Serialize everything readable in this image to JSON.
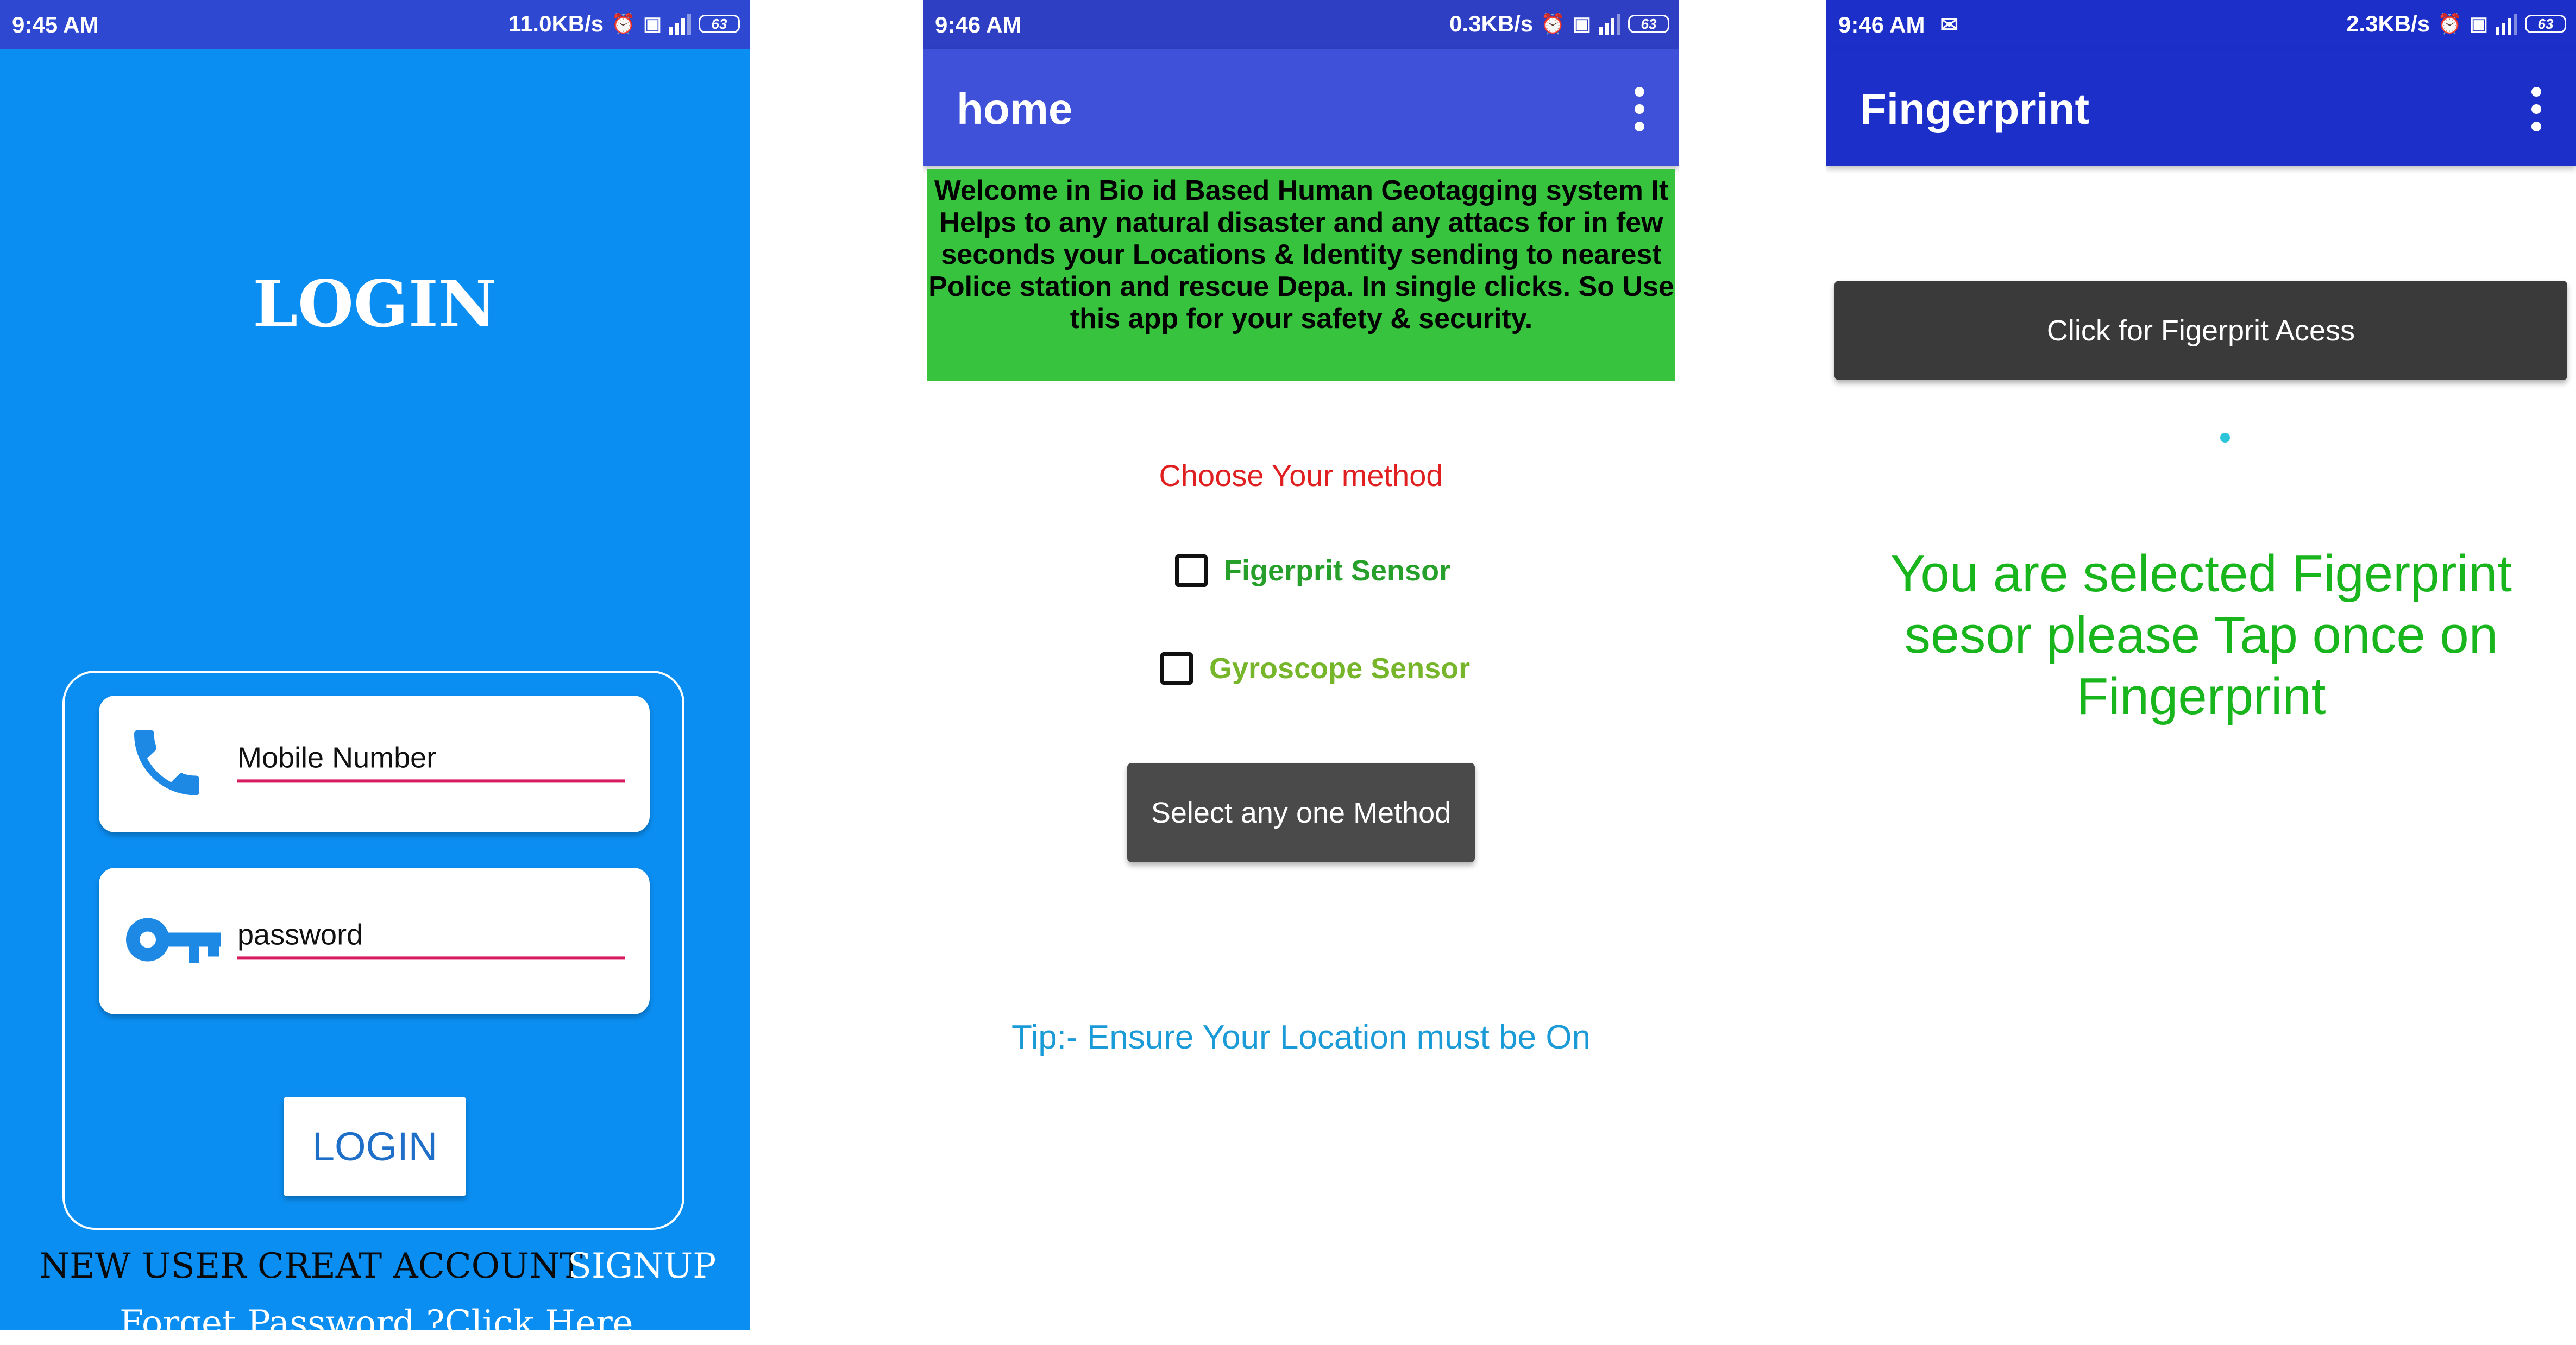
{
  "login_screen": {
    "status": {
      "time": "9:45 AM",
      "speed": "11.0KB/s",
      "battery": "63"
    },
    "title": "LOGIN",
    "mobile_placeholder": "Mobile Number",
    "password_placeholder": "password",
    "login_button": "LOGIN",
    "new_user_text": "NEW USER CREAT ACCOUNT",
    "signup_link": "SIGNUP",
    "forgot_text": "Forget Password ?Click Here",
    "icons": {
      "mobile": "phone-icon",
      "password": "key-icon"
    }
  },
  "home_screen": {
    "status": {
      "time": "9:46 AM",
      "speed": "0.3KB/s",
      "battery": "63"
    },
    "app_title": "home",
    "welcome_text": "Welcome in Bio id Based Human Geotagging system  It Helps to any natural disaster and any attacs for in few seconds your Locations & Identity sending  to nearest Police station and rescue Depa. In single clicks. So Use this app for your safety & security.",
    "choose_label": "Choose Your method",
    "options": [
      {
        "label": "Figerprit Sensor",
        "checked": false
      },
      {
        "label": "Gyroscope Sensor",
        "checked": false
      }
    ],
    "select_button": "Select any one Method",
    "tip": "Tip:- Ensure Your Location must be On"
  },
  "fingerprint_screen": {
    "status": {
      "time": "9:46 AM",
      "speed": "2.3KB/s",
      "battery": "63"
    },
    "app_title": "Fingerprint",
    "access_button": "Click for Figerprit Acess",
    "message": "You are selected Figerprint sesor please  Tap once on Fingerprint"
  },
  "colors": {
    "login_bg": "#0b8ef2",
    "appbar_home": "#3f51d9",
    "appbar_fingerprint": "#1c2fc8",
    "welcome_bg": "#37c33d",
    "input_underline": "#d81b60",
    "choose_label": "#e02020",
    "tip": "#1a9ad6",
    "fingerprint_message": "#19b51d"
  }
}
